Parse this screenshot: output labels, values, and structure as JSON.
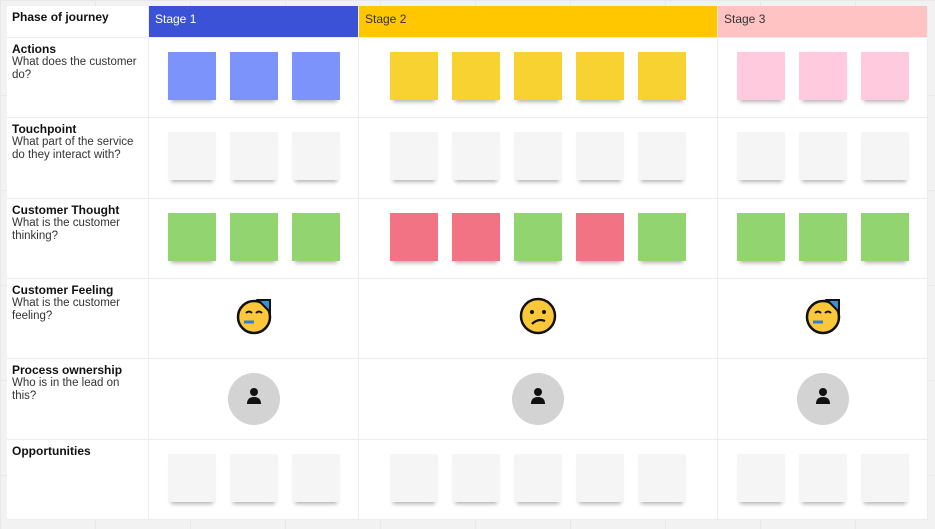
{
  "header": {
    "label": "Phase of journey",
    "stages": [
      {
        "label": "Stage 1",
        "bg": "#3b52d6",
        "fg": "#ffffff"
      },
      {
        "label": "Stage 2",
        "bg": "#ffc700",
        "fg": "#333333"
      },
      {
        "label": "Stage 3",
        "bg": "#ffc3c3",
        "fg": "#333333"
      }
    ]
  },
  "colors": {
    "blue": "#7b93fb",
    "yellow": "#f8d230",
    "pink": "#ffc9de",
    "white": "#f5f5f5",
    "green": "#92d46f",
    "red": "#f27384"
  },
  "rows": [
    {
      "title": "Actions",
      "subtitle": "What does the customer do?",
      "cells": [
        [
          "blue",
          "blue",
          "blue"
        ],
        [
          "yellow",
          "yellow",
          "yellow",
          "yellow",
          "yellow"
        ],
        [
          "pink",
          "pink",
          "pink"
        ]
      ]
    },
    {
      "title": "Touchpoint",
      "subtitle": "What part of the service do they interact with?",
      "cells": [
        [
          "white",
          "white",
          "white"
        ],
        [
          "white",
          "white",
          "white",
          "white",
          "white"
        ],
        [
          "white",
          "white",
          "white"
        ]
      ]
    },
    {
      "title": "Customer Thought",
      "subtitle": "What is the customer thinking?",
      "cells": [
        [
          "green",
          "green",
          "green"
        ],
        [
          "red",
          "red",
          "green",
          "red",
          "green"
        ],
        [
          "green",
          "green",
          "green"
        ]
      ]
    },
    {
      "title": "Customer Feeling",
      "subtitle": "What is the customer feeling?",
      "emoji": [
        "partying-face",
        "confused-face",
        "partying-face"
      ]
    },
    {
      "title": "Process ownership",
      "subtitle": "Who is in the lead on this?",
      "avatar": [
        "user",
        "user",
        "user"
      ]
    },
    {
      "title": "Opportunities",
      "subtitle": "",
      "cells": [
        [
          "white",
          "white",
          "white"
        ],
        [
          "white",
          "white",
          "white",
          "white",
          "white"
        ],
        [
          "white",
          "white",
          "white"
        ]
      ]
    }
  ]
}
